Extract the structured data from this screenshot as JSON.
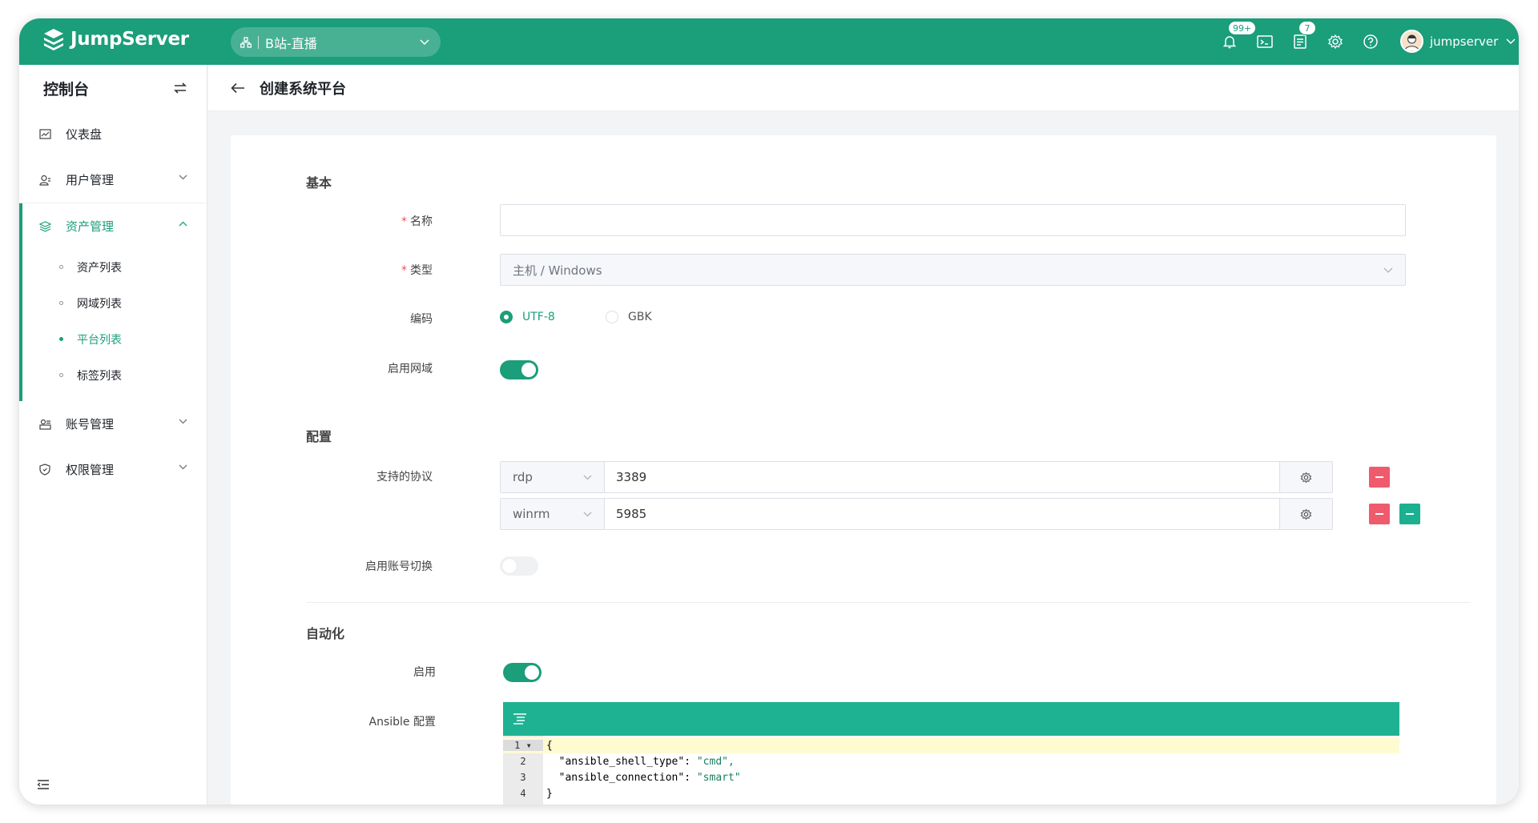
{
  "topbar": {
    "brand": "JumpServer",
    "org": "B站-直播",
    "notifications_badge": "99+",
    "tickets_badge": "7",
    "username": "jumpserver"
  },
  "sidebar": {
    "title": "控制台",
    "items": [
      {
        "label": "仪表盘",
        "icon": "dashboard-icon"
      },
      {
        "label": "用户管理",
        "icon": "user-icon"
      },
      {
        "label": "资产管理",
        "icon": "asset-icon"
      },
      {
        "label": "账号管理",
        "icon": "account-icon"
      },
      {
        "label": "权限管理",
        "icon": "permission-icon"
      }
    ],
    "asset_sub": [
      "资产列表",
      "网域列表",
      "平台列表",
      "标签列表"
    ]
  },
  "page": {
    "title": "创建系统平台"
  },
  "form": {
    "basic_title": "基本",
    "name_label": "名称",
    "name_value": "",
    "type_label": "类型",
    "type_value": "主机 / Windows",
    "encoding_label": "编码",
    "encoding_options": [
      "UTF-8",
      "GBK"
    ],
    "encoding_selected": "UTF-8",
    "domain_label": "启用网域",
    "domain_enabled": true,
    "config_title": "配置",
    "protocols_label": "支持的协议",
    "protocols": [
      {
        "name": "rdp",
        "port": "3389"
      },
      {
        "name": "winrm",
        "port": "5985"
      }
    ],
    "su_label": "启用账号切换",
    "su_enabled": false,
    "automation_title": "自动化",
    "automation_enable_label": "启用",
    "automation_enabled": true,
    "ansible_label": "Ansible 配置",
    "ansible_lines": [
      {
        "n": "1",
        "code": "{"
      },
      {
        "n": "2",
        "key": "\"ansible_shell_type\"",
        "val": "\"cmd\","
      },
      {
        "n": "3",
        "key": "\"ansible_connection\"",
        "val": "\"smart\""
      },
      {
        "n": "4",
        "code": "}"
      }
    ]
  },
  "colors": {
    "primary": "#1b9e7a",
    "danger": "#ef5b6c",
    "editor_bar": "#1eb293"
  }
}
